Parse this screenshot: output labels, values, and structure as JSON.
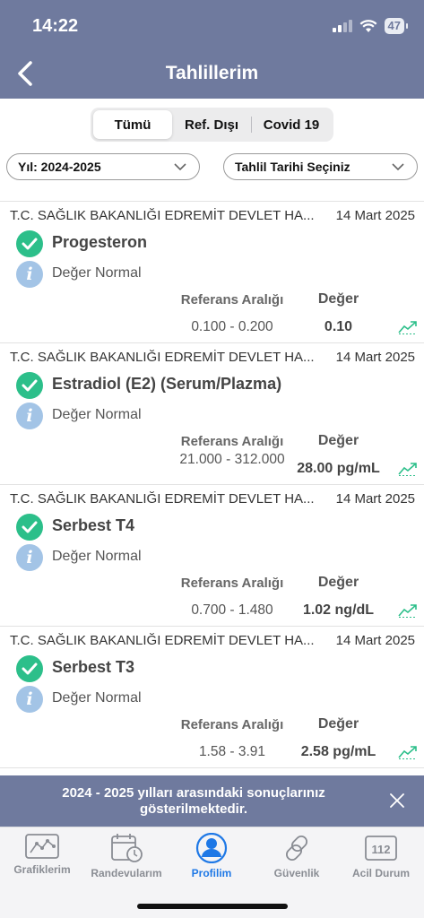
{
  "status_bar": {
    "time": "14:22",
    "battery": "47"
  },
  "header": {
    "title": "Tahlillerim"
  },
  "segments": [
    {
      "label": "Tümü",
      "active": true
    },
    {
      "label": "Ref. Dışı",
      "active": false
    },
    {
      "label": "Covid 19",
      "active": false
    }
  ],
  "filters": {
    "year": "Yıl: 2024-2025",
    "date": "Tahlil Tarihi Seçiniz"
  },
  "columns": {
    "reference": "Referans Aralığı",
    "value": "Değer"
  },
  "results": [
    {
      "hospital": "T.C. SAĞLIK BAKANLIĞI EDREMİT DEVLET HA...",
      "date": "14 Mart 2025",
      "test": "Progesteron",
      "status": "Değer Normal",
      "reference": "0.100 - 0.200",
      "value": "0.10"
    },
    {
      "hospital": "T.C. SAĞLIK BAKANLIĞI EDREMİT DEVLET HA...",
      "date": "14 Mart 2025",
      "test": "Estradiol (E2) (Serum/Plazma)",
      "status": "Değer Normal",
      "reference": "21.000 - 312.000",
      "value": "28.00 pg/mL"
    },
    {
      "hospital": "T.C. SAĞLIK BAKANLIĞI EDREMİT DEVLET HA...",
      "date": "14 Mart 2025",
      "test": "Serbest T4",
      "status": "Değer Normal",
      "reference": "0.700 - 1.480",
      "value": "1.02 ng/dL"
    },
    {
      "hospital": "T.C. SAĞLIK BAKANLIĞI EDREMİT DEVLET HA...",
      "date": "14 Mart 2025",
      "test": "Serbest T3",
      "status": "Değer Normal",
      "reference": "1.58 - 3.91",
      "value": "2.58 pg/mL"
    }
  ],
  "banner": {
    "text": "2024 - 2025 yılları arasındaki sonuçlarınız gösterilmektedir."
  },
  "tabs": [
    {
      "label": "Grafiklerim",
      "icon": "chart-icon",
      "active": false
    },
    {
      "label": "Randevularım",
      "icon": "calendar-clock-icon",
      "active": false
    },
    {
      "label": "Profilim",
      "icon": "profile-icon",
      "active": true
    },
    {
      "label": "Güvenlik",
      "icon": "link-icon",
      "active": false
    },
    {
      "label": "Acil Durum",
      "icon": "emergency-112-icon",
      "active": false,
      "badge": "112"
    }
  ],
  "colors": {
    "header": "#6f7a9e",
    "check": "#2cbf8a",
    "info": "#a3c4e6",
    "active_tab": "#1e78e6",
    "trend": "#2cbf8a"
  }
}
